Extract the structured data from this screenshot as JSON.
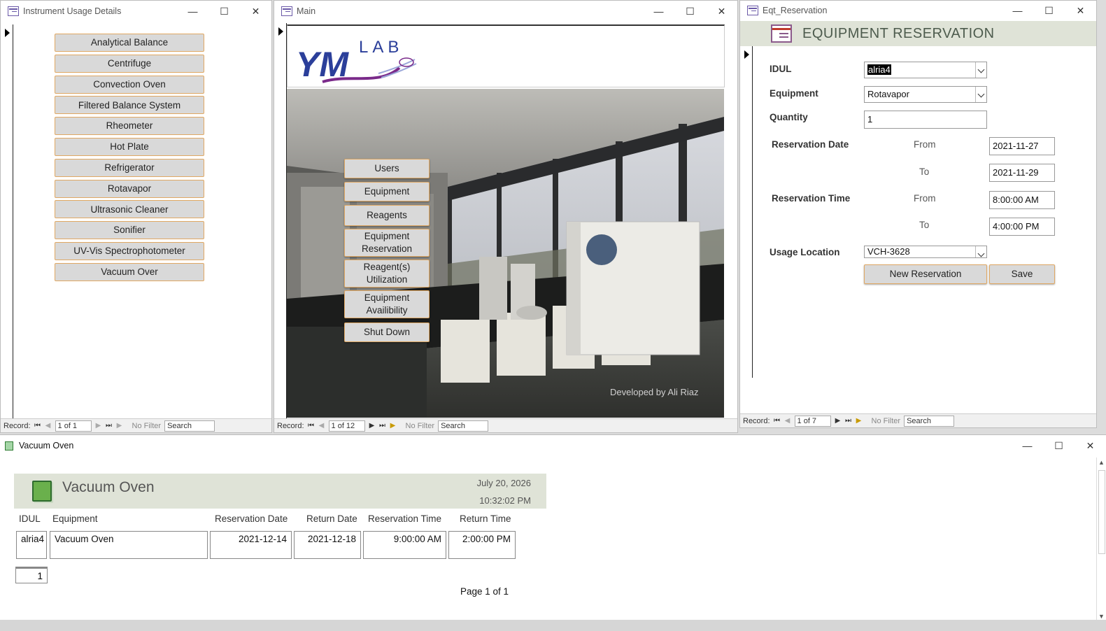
{
  "windows": {
    "instrument": {
      "title": "Instrument Usage Details",
      "buttons": [
        "Analytical Balance",
        "Centrifuge",
        "Convection Oven",
        "Filtered Balance System",
        "Rheometer",
        "Hot Plate",
        "Refrigerator",
        "Rotavapor",
        "Ultrasonic Cleaner",
        "Sonifier",
        "UV-Vis Spectrophotometer",
        "Vacuum Over"
      ],
      "record": {
        "label": "Record:",
        "position": "1 of 1",
        "filter": "No Filter",
        "search": "Search"
      }
    },
    "main": {
      "title": "Main",
      "logo": {
        "ym": "YM",
        "lab": "LAB"
      },
      "menu": [
        "Users",
        "Equipment",
        "Reagents",
        "Equipment Reservation",
        "Reagent(s) Utilization",
        "Equipment Availibility",
        "Shut Down"
      ],
      "credit": "Developed by Ali Riaz",
      "record": {
        "label": "Record:",
        "position": "1 of 12",
        "filter": "No Filter",
        "search": "Search"
      }
    },
    "reservation": {
      "title": "Eqt_Reservation",
      "heading": "EQUIPMENT RESERVATION",
      "labels": {
        "idul": "IDUL",
        "equipment": "Equipment",
        "quantity": "Quantity",
        "res_date": "Reservation Date",
        "res_time": "Reservation Time",
        "from": "From",
        "to": "To",
        "location": "Usage Location"
      },
      "values": {
        "idul": "alria4",
        "equipment": "Rotavapor",
        "quantity": "1",
        "date_from": "2021-11-27",
        "date_to": "2021-11-29",
        "time_from": "8:00:00 AM",
        "time_to": "4:00:00 PM",
        "location": "VCH-3628"
      },
      "buttons": {
        "new": "New Reservation",
        "save": "Save"
      },
      "record": {
        "label": "Record:",
        "position": "1 of 7",
        "filter": "No Filter",
        "search": "Search"
      }
    },
    "report": {
      "title": "Vacuum Oven",
      "heading": "Vacuum Oven",
      "date": "July 20, 2026",
      "time": "10:32:02 PM",
      "columns": [
        "IDUL",
        "Equipment",
        "Reservation Date",
        "Return Date",
        "Reservation Time",
        "Return Time"
      ],
      "row": [
        "alria4",
        "Vacuum Oven",
        "2021-12-14",
        "2021-12-18",
        "9:00:00 AM",
        "2:00:00 PM"
      ],
      "count": "1",
      "page": "Page 1 of 1"
    }
  },
  "colors": {
    "accent_border": "#e0a863",
    "button_bg": "#d9d9d9",
    "header_band": "#dfe3d7",
    "logo_blue": "#2b3f9a",
    "logo_purple": "#7a2a8a"
  }
}
